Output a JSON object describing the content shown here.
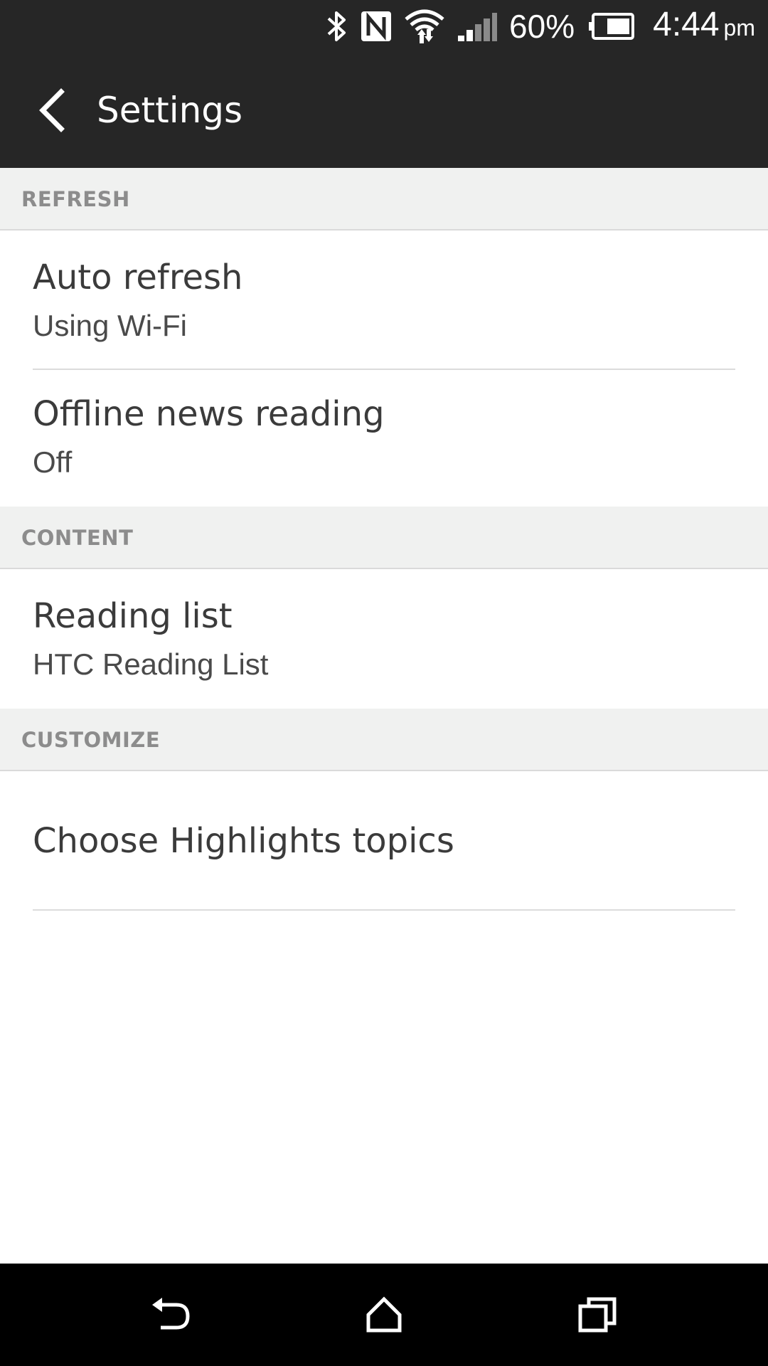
{
  "status_bar": {
    "icons": [
      "bluetooth-icon",
      "nfc-icon",
      "wifi-icon",
      "signal-icon",
      "battery-icon"
    ],
    "battery_percent": "60%",
    "time": "4:44",
    "ampm": "pm"
  },
  "app_bar": {
    "back_icon": "chevron-left-icon",
    "title": "Settings"
  },
  "sections": {
    "refresh": {
      "header": "REFRESH",
      "items": [
        {
          "title": "Auto refresh",
          "subtitle": "Using Wi-Fi"
        },
        {
          "title": "Offline news reading",
          "subtitle": "Off"
        }
      ]
    },
    "content": {
      "header": "CONTENT",
      "items": [
        {
          "title": "Reading list",
          "subtitle": "HTC Reading List"
        }
      ]
    },
    "customize": {
      "header": "CUSTOMIZE",
      "items": [
        {
          "title": "Choose Highlights topics"
        }
      ]
    }
  },
  "nav_bar": {
    "buttons": [
      "back-icon",
      "home-icon",
      "recent-apps-icon"
    ]
  },
  "colors": {
    "app_bar": "#262626",
    "section_header_bg": "#f0f1f0",
    "section_header_text": "#8c8c8c",
    "item_title": "#3b3b3b",
    "nav_bar": "#000000"
  }
}
